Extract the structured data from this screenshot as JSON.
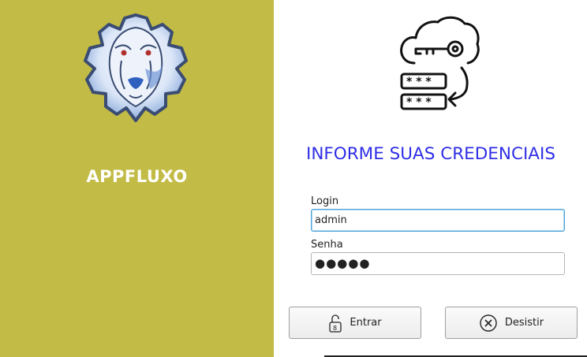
{
  "app": {
    "name": "APPFLUXO",
    "logo_icon": "cheetah-gear-logo"
  },
  "form": {
    "heading": "INFORME SUAS CREDENCIAIS",
    "hero_icon": "key-password-icon",
    "login_label": "Login",
    "login_value": "admin",
    "password_label": "Senha",
    "password_value": "●●●●●"
  },
  "buttons": {
    "enter_label": "Entrar",
    "enter_icon": "unlock-icon",
    "quit_label": "Desistir",
    "quit_icon": "cancel-circle-icon"
  },
  "colors": {
    "left_panel": "#c2bb45",
    "heading": "#2f2fe6"
  }
}
